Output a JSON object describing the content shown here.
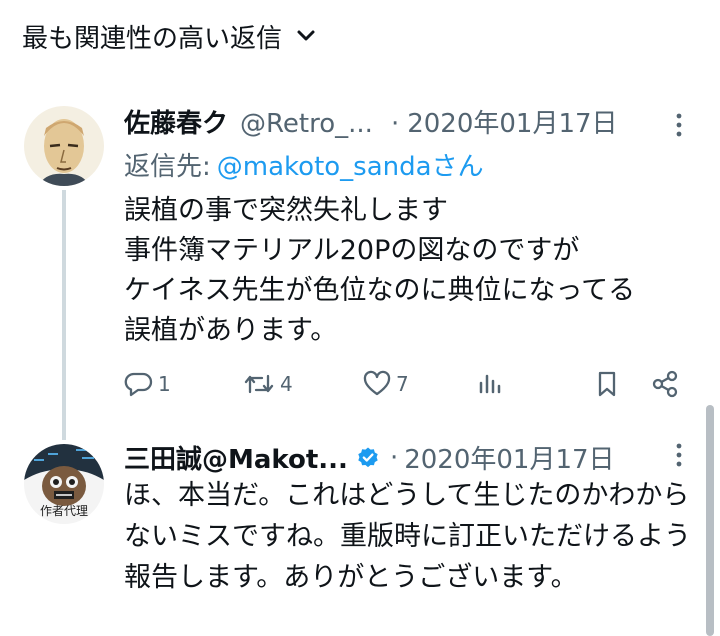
{
  "sort": {
    "label": "最も関連性の高い返信",
    "icon": "chevron-down-icon"
  },
  "tweets": [
    {
      "name": "佐藤春ク",
      "handle": "@Retro_...",
      "date": "2020年01月17日",
      "reply_to_label": "返信先:",
      "reply_to_mention": "@makoto_sanda",
      "reply_to_suffix": "さん",
      "body": "誤植の事で突然失礼します\n事件簿マテリアル20Pの図なのですが\nケイネス先生が色位なのに典位になってる\n誤植があります。",
      "stats": {
        "replies": "1",
        "retweets": "4",
        "likes": "7"
      }
    },
    {
      "name": "三田誠@Makot...",
      "verified": true,
      "date": "2020年01月17日",
      "body": "ほ、本当だ。これはどうして生じたのかわからないミスですね。重版時に訂正いただけるよう報告します。ありがとうございます。",
      "avatar_caption": "作者代理"
    }
  ],
  "colors": {
    "link": "#1d9bf0",
    "muted": "#536471",
    "text": "#0f1419"
  }
}
